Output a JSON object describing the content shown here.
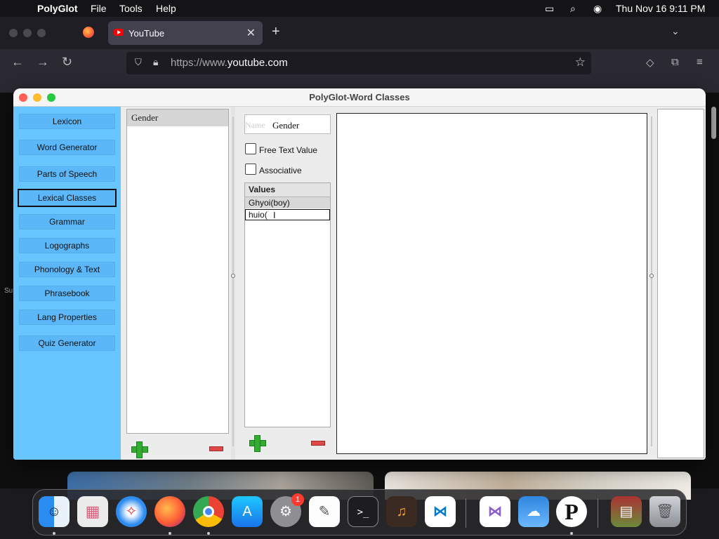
{
  "menubar": {
    "app_name": "PolyGlot",
    "menus": [
      "File",
      "Tools",
      "Help"
    ],
    "datetime": "Thu Nov 16  9:11 PM"
  },
  "browser": {
    "tab_title": "YouTube",
    "url_prefix": "https://www.",
    "url_domain": "youtube.com",
    "page_side_text": "Sul"
  },
  "polyglot": {
    "window_title": "PolyGlot-Word Classes",
    "sidebar": [
      "Lexicon",
      "Word Generator",
      "Parts of Speech",
      "Lexical Classes",
      "Grammar",
      "Logographs",
      "Phonology & Text",
      "Phrasebook",
      "Lang Properties",
      "Quiz Generator"
    ],
    "active_sidebar": "Lexical Classes",
    "class_list": [
      "Gender"
    ],
    "name_placeholder": "Name",
    "name_value": "Gender",
    "free_text_label": "Free Text Value",
    "associative_label": "Associative",
    "values_header": "Values",
    "values": [
      "Ghyoi(boy)"
    ],
    "editing_value": "huio("
  },
  "dock": {
    "apps": [
      "Finder",
      "Launchpad",
      "Safari",
      "Firefox",
      "Chrome",
      "App Store",
      "System Settings",
      "TextEdit",
      "Terminal",
      "GarageBand",
      "VS Code",
      "Visual Studio",
      "Weather",
      "PolyGlot",
      "Preview",
      "Trash"
    ],
    "settings_badge": "1"
  },
  "colors": {
    "sidebar_bg": "#67c6ff",
    "sidebar_button": "#5bb7f7",
    "add_green": "#2fae2f",
    "remove_red": "#e04848"
  }
}
